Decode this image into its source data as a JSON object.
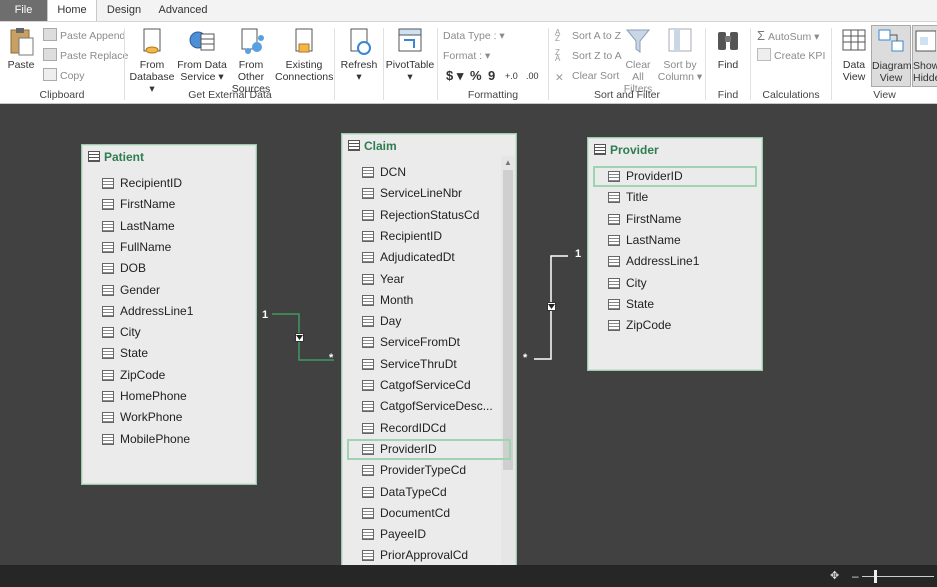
{
  "tabs": {
    "file": "File",
    "home": "Home",
    "design": "Design",
    "advanced": "Advanced"
  },
  "ribbon": {
    "clipboard": {
      "label": "Clipboard",
      "paste": "Paste",
      "paste_append": "Paste Append",
      "paste_replace": "Paste Replace",
      "copy": "Copy"
    },
    "external": {
      "label": "Get External Data",
      "from_database_1": "From",
      "from_database_2": "Database",
      "from_data_service_1": "From Data",
      "from_data_service_2": "Service",
      "from_other_1": "From Other",
      "from_other_2": "Sources",
      "existing_1": "Existing",
      "existing_2": "Connections"
    },
    "refresh": "Refresh",
    "pivottable": "PivotTable",
    "formatting": {
      "label": "Formatting",
      "data_type": "Data Type :",
      "format": "Format :",
      "currency": "$",
      "percent": "%",
      "comma": "9"
    },
    "sort_filter": {
      "label": "Sort and Filter",
      "sort_az": "Sort A to Z",
      "sort_za": "Sort Z to A",
      "clear_sort": "Clear Sort",
      "clear_filters_1": "Clear All",
      "clear_filters_2": "Filters",
      "sort_by_col_1": "Sort by",
      "sort_by_col_2": "Column"
    },
    "find": {
      "label": "Find",
      "find": "Find"
    },
    "calculations": {
      "label": "Calculations",
      "autosum": "AutoSum",
      "create_kpi": "Create KPI"
    },
    "view": {
      "label": "View",
      "data_view_1": "Data",
      "data_view_2": "View",
      "diagram_view_1": "Diagram",
      "diagram_view_2": "View",
      "show_hidden_1": "Show",
      "show_hidden_2": "Hidde"
    }
  },
  "tables": {
    "patient": {
      "title": "Patient",
      "columns": [
        "RecipientID",
        "FirstName",
        "LastName",
        "FullName",
        "DOB",
        "Gender",
        "AddressLine1",
        "City",
        "State",
        "ZipCode",
        "HomePhone",
        "WorkPhone",
        "MobilePhone"
      ]
    },
    "claim": {
      "title": "Claim",
      "columns": [
        "DCN",
        "ServiceLineNbr",
        "RejectionStatusCd",
        "RecipientID",
        "AdjudicatedDt",
        "Year",
        "Month",
        "Day",
        "ServiceFromDt",
        "ServiceThruDt",
        "CatgofServiceCd",
        "CatgofServiceDesc...",
        "RecordIDCd",
        "ProviderID",
        "ProviderTypeCd",
        "DataTypeCd",
        "DocumentCd",
        "PayeeID",
        "PriorApprovalCd"
      ]
    },
    "provider": {
      "title": "Provider",
      "columns": [
        "ProviderID",
        "Title",
        "FirstName",
        "LastName",
        "AddressLine1",
        "City",
        "State",
        "ZipCode"
      ]
    }
  },
  "relationships": {
    "one": "1",
    "many": "*"
  },
  "colors": {
    "canvas": "#414141",
    "accent_green": "#2f7d4f",
    "selection": "#9fd4b2"
  }
}
